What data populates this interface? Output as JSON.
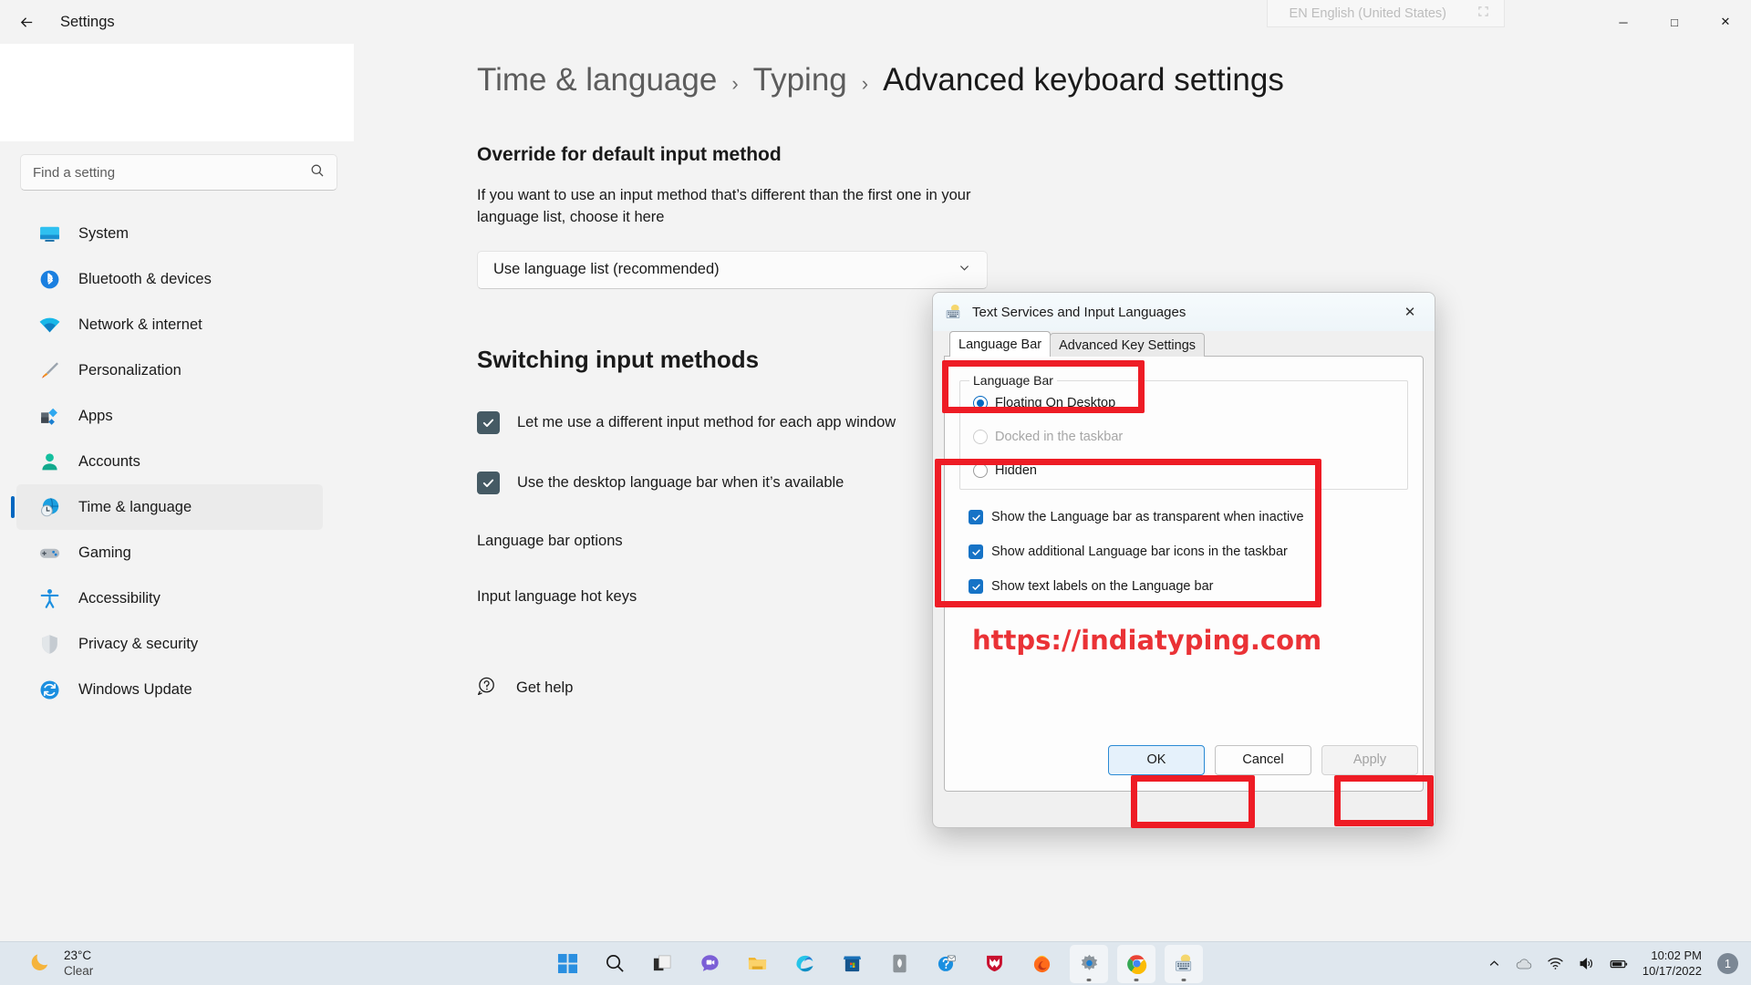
{
  "window": {
    "title": "Settings",
    "back_icon": "back-arrow-icon",
    "minimize": "─",
    "maximize": "□",
    "close": "✕"
  },
  "language_flyout": {
    "label": "EN English (United States)",
    "expand_icon": "expand-icon"
  },
  "sidebar": {
    "search": {
      "placeholder": "Find a setting",
      "value": "",
      "icon": "search-icon"
    },
    "items": [
      {
        "label": "System",
        "icon": "system-icon",
        "active": false
      },
      {
        "label": "Bluetooth & devices",
        "icon": "bluetooth-icon",
        "active": false
      },
      {
        "label": "Network & internet",
        "icon": "network-icon",
        "active": false
      },
      {
        "label": "Personalization",
        "icon": "personalization-icon",
        "active": false
      },
      {
        "label": "Apps",
        "icon": "apps-icon",
        "active": false
      },
      {
        "label": "Accounts",
        "icon": "accounts-icon",
        "active": false
      },
      {
        "label": "Time & language",
        "icon": "time-language-icon",
        "active": true
      },
      {
        "label": "Gaming",
        "icon": "gaming-icon",
        "active": false
      },
      {
        "label": "Accessibility",
        "icon": "accessibility-icon",
        "active": false
      },
      {
        "label": "Privacy & security",
        "icon": "privacy-security-icon",
        "active": false
      },
      {
        "label": "Windows Update",
        "icon": "windows-update-icon",
        "active": false
      }
    ]
  },
  "content": {
    "breadcrumb": {
      "root": "Time & language",
      "mid": "Typing",
      "current": "Advanced keyboard settings",
      "separator": "›"
    },
    "override_section": {
      "title": "Override for default input method",
      "description": "If you want to use an input method that’s different than the first one in your language list, choose it here",
      "dropdown_value": "Use language list (recommended)",
      "dropdown_icon": "chevron-down-icon"
    },
    "switching_section": {
      "title": "Switching input methods",
      "checkboxes": [
        {
          "label": "Let me use a different input method for each app window",
          "checked": true
        },
        {
          "label": "Use the desktop language bar when it’s available",
          "checked": true
        }
      ],
      "links": [
        "Language bar options",
        "Input language hot keys"
      ]
    },
    "get_help": {
      "label": "Get help",
      "icon": "help-icon"
    }
  },
  "dialog": {
    "title": "Text Services and Input Languages",
    "icon": "keyboard-icon",
    "close_icon": "close-icon",
    "tabs": [
      {
        "label": "Language Bar",
        "active": true
      },
      {
        "label": "Advanced Key Settings",
        "active": false
      }
    ],
    "language_bar_group": {
      "legend": "Language Bar",
      "options": [
        {
          "label": "Floating On Desktop",
          "selected": true,
          "disabled": false
        },
        {
          "label": "Docked in the taskbar",
          "selected": false,
          "disabled": true
        },
        {
          "label": "Hidden",
          "selected": false,
          "disabled": false
        }
      ]
    },
    "checkboxes": [
      {
        "label": "Show the Language bar as transparent when inactive",
        "checked": true
      },
      {
        "label": "Show additional Language bar icons in the taskbar",
        "checked": true
      },
      {
        "label": "Show text labels on the Language bar",
        "checked": true
      }
    ],
    "watermark": "https://indiatyping.com",
    "buttons": [
      {
        "label": "OK",
        "style": "primary"
      },
      {
        "label": "Cancel",
        "style": "normal"
      },
      {
        "label": "Apply",
        "style": "disabled"
      }
    ]
  },
  "taskbar": {
    "weather": {
      "temperature": "23°C",
      "condition": "Clear",
      "icon": "moon-icon"
    },
    "apps": [
      {
        "name": "start-button",
        "icon": "windows-logo-icon",
        "running": false
      },
      {
        "name": "search-taskbar-button",
        "icon": "search-icon",
        "running": false
      },
      {
        "name": "task-view-button",
        "icon": "task-view-icon",
        "running": false
      },
      {
        "name": "chat-button",
        "icon": "chat-icon",
        "running": false
      },
      {
        "name": "file-explorer-button",
        "icon": "folder-icon",
        "running": false
      },
      {
        "name": "edge-button",
        "icon": "edge-icon",
        "running": false
      },
      {
        "name": "microsoft-store-button",
        "icon": "store-icon",
        "running": false
      },
      {
        "name": "app-button-grey",
        "icon": "leaf-icon",
        "running": false
      },
      {
        "name": "help-app-button",
        "icon": "help-mail-icon",
        "running": false
      },
      {
        "name": "mcafee-button",
        "icon": "shield-m-icon",
        "running": false
      },
      {
        "name": "firefox-button",
        "icon": "firefox-icon",
        "running": false
      },
      {
        "name": "settings-taskbar-button",
        "icon": "gear-icon",
        "running": true
      },
      {
        "name": "chrome-button",
        "icon": "chrome-icon",
        "running": true
      },
      {
        "name": "text-services-button",
        "icon": "keyboard-icon",
        "running": true
      }
    ],
    "tray": {
      "show_hidden_icon": "chevron-up-icon",
      "cloud_icon": "cloud-icon",
      "wifi_icon": "wifi-icon",
      "volume_icon": "volume-icon",
      "battery_icon": "battery-icon",
      "time": "10:02 PM",
      "date": "10/17/2022",
      "notification_count": "1"
    }
  },
  "annotations": {
    "color": "#ee1c25",
    "boxes": [
      "radio-floating-on-desktop",
      "dialog-checkbox-group",
      "ok-button",
      "apply-button"
    ]
  }
}
